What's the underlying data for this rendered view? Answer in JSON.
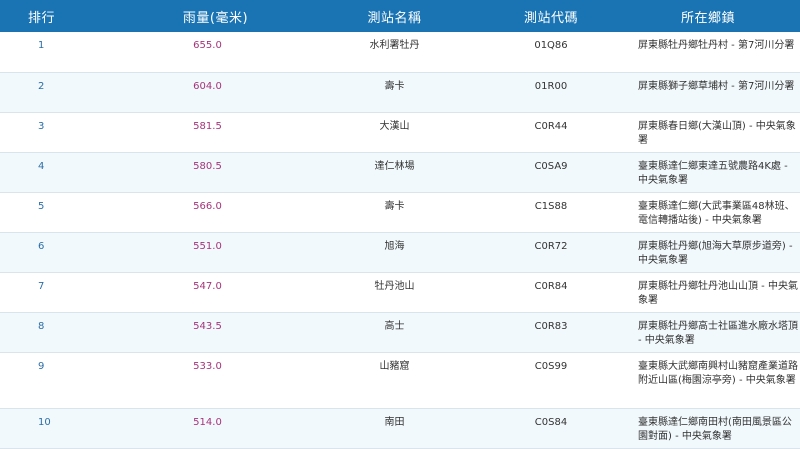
{
  "headers": {
    "rank": "排行",
    "rain": "雨量(毫米)",
    "name": "測站名稱",
    "code": "測站代碼",
    "location": "所在鄉鎮"
  },
  "rows": [
    {
      "rank": "1",
      "rain": "655.0",
      "name": "水利署牡丹",
      "code": "01Q86",
      "location": "屏東縣牡丹鄉牡丹村 - 第7河川分署"
    },
    {
      "rank": "2",
      "rain": "604.0",
      "name": "壽卡",
      "code": "01R00",
      "location": "屏東縣獅子鄉草埔村 - 第7河川分署"
    },
    {
      "rank": "3",
      "rain": "581.5",
      "name": "大漢山",
      "code": "C0R44",
      "location": "屏東縣春日鄉(大漢山頂) - 中央氣象署"
    },
    {
      "rank": "4",
      "rain": "580.5",
      "name": "達仁林場",
      "code": "C0SA9",
      "location": "臺東縣達仁鄉東達五號農路4K處 - 中央氣象署"
    },
    {
      "rank": "5",
      "rain": "566.0",
      "name": "壽卡",
      "code": "C1S88",
      "location": "臺東縣達仁鄉(大武事業區48林班、電信轉播站後) - 中央氣象署"
    },
    {
      "rank": "6",
      "rain": "551.0",
      "name": "旭海",
      "code": "C0R72",
      "location": "屏東縣牡丹鄉(旭海大草原步道旁) - 中央氣象署"
    },
    {
      "rank": "7",
      "rain": "547.0",
      "name": "牡丹池山",
      "code": "C0R84",
      "location": "屏東縣牡丹鄉牡丹池山山頂 - 中央氣象署"
    },
    {
      "rank": "8",
      "rain": "543.5",
      "name": "高士",
      "code": "C0R83",
      "location": "屏東縣牡丹鄉高士社區進水廠水塔頂 - 中央氣象署"
    },
    {
      "rank": "9",
      "rain": "533.0",
      "name": "山豬窟",
      "code": "C0S99",
      "location": "臺東縣大武鄉南興村山豬窟產業道路附近山區(梅園涼亭旁) - 中央氣象署"
    },
    {
      "rank": "10",
      "rain": "514.0",
      "name": "南田",
      "code": "C0S84",
      "location": "臺東縣達仁鄉南田村(南田風景區公園對面) - 中央氣象署"
    }
  ]
}
